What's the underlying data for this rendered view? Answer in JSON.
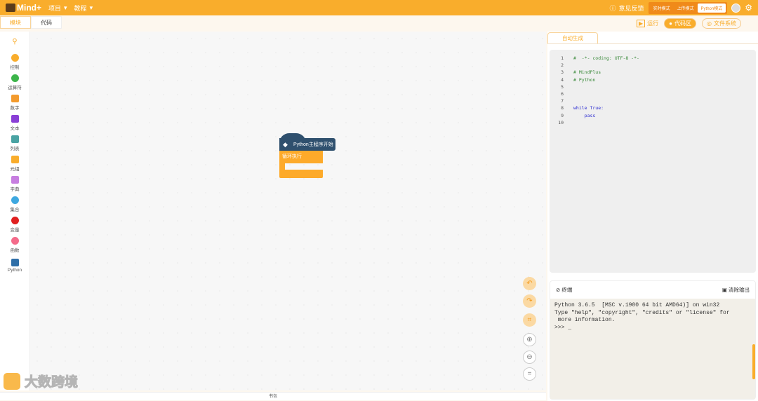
{
  "header": {
    "logo": "Mind+",
    "menus": [
      "项目",
      "教程"
    ],
    "feedback": "意见反馈",
    "modes": [
      "实时模式",
      "上传模式",
      "Python模式"
    ],
    "active_mode": "Python模式",
    "accent": "#f9ad2c"
  },
  "tabs": [
    "模块",
    "代码"
  ],
  "actions": {
    "run": "运行",
    "code_area": "代码区",
    "file_system": "文件系统"
  },
  "categories": [
    {
      "label": "控制",
      "color": "#f9ad2c"
    },
    {
      "label": "运算符",
      "color": "#3cb54a"
    },
    {
      "label": "数字",
      "color": "#f39b2e"
    },
    {
      "label": "文本",
      "color": "#8a3fd6"
    },
    {
      "label": "列表",
      "color": "#4aa3a3"
    },
    {
      "label": "元组",
      "color": "#f9ad2c"
    },
    {
      "label": "字典",
      "color": "#c77ee0"
    },
    {
      "label": "集合",
      "color": "#3ea8e0"
    },
    {
      "label": "变量",
      "color": "#e02020"
    },
    {
      "label": "函数",
      "color": "#f46b8a"
    },
    {
      "label": "Python",
      "color": "#2f6fa8"
    }
  ],
  "blocks": {
    "hat": "Python主程序开始",
    "loop": "循环执行"
  },
  "bottom_bar": "书包",
  "code_panel": {
    "tab": "自动生成",
    "lines": [
      "#  -*- coding: UTF-8 -*-",
      "",
      "# MindPlus",
      "# Python",
      "",
      "",
      "",
      "while True:",
      "    pass",
      ""
    ]
  },
  "terminal": {
    "title": "终端",
    "clear": "清除输出",
    "output": "Python 3.6.5  [MSC v.1900 64 bit AMD64)] on win32\nType \"help\", \"copyright\", \"credits\" or \"license\" for\n more information.\n>>> _"
  },
  "watermark": "大数跨境"
}
